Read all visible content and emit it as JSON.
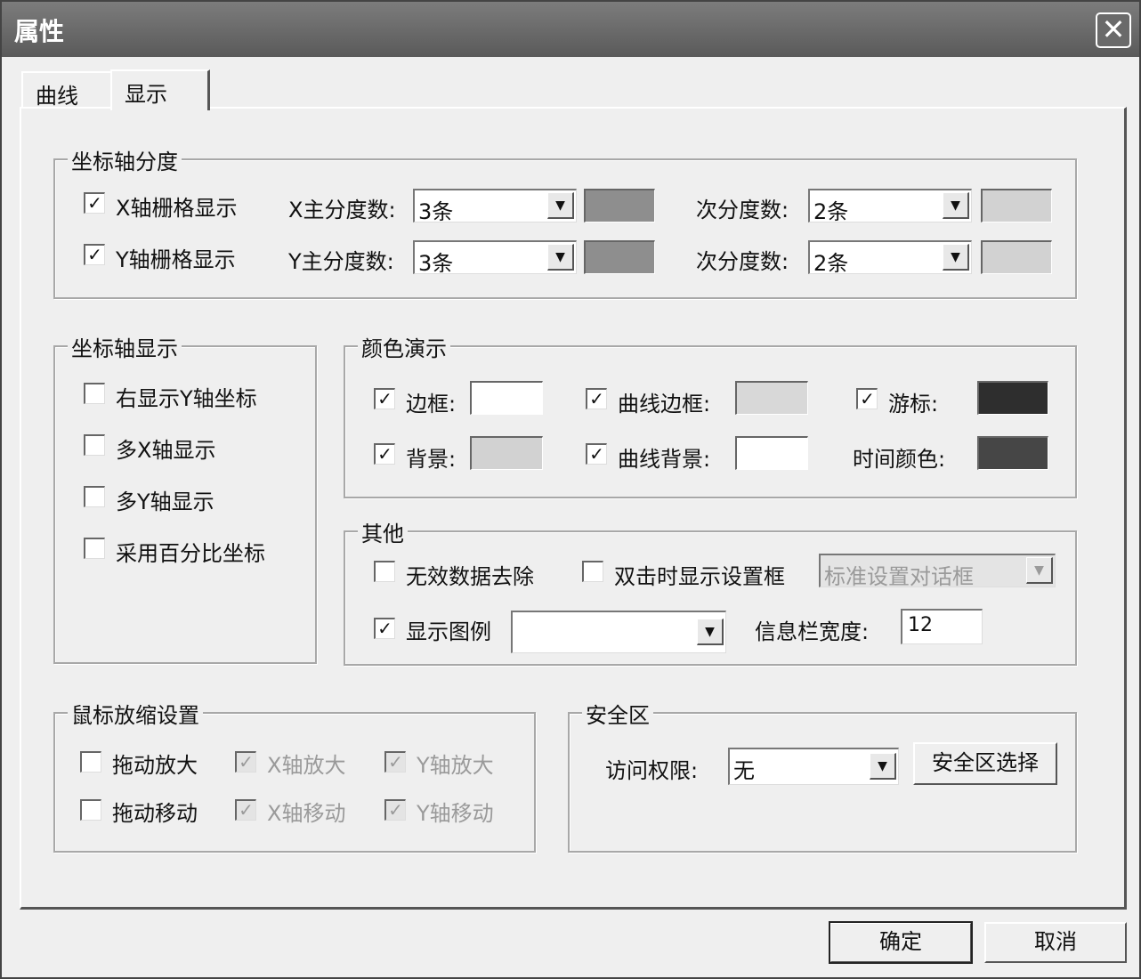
{
  "window": {
    "title": "属性",
    "close_glyph": "✕"
  },
  "tabs": [
    {
      "label": "曲线"
    },
    {
      "label": "显示"
    }
  ],
  "axis_division": {
    "legend": "坐标轴分度",
    "x_grid_label": "X轴栅格显示",
    "x_grid_checked": true,
    "y_grid_label": "Y轴栅格显示",
    "y_grid_checked": true,
    "x_major_label": "X主分度数:",
    "x_major_value": "3条",
    "x_major_color": "#8e8e8e",
    "x_minor_label": "次分度数:",
    "x_minor_value": "2条",
    "x_minor_color": "#d2d2d2",
    "y_major_label": "Y主分度数:",
    "y_major_value": "3条",
    "y_major_color": "#8e8e8e",
    "y_minor_label": "次分度数:",
    "y_minor_value": "2条",
    "y_minor_color": "#d2d2d2"
  },
  "axis_display": {
    "legend": "坐标轴显示",
    "items": [
      {
        "label": "右显示Y轴坐标",
        "checked": false
      },
      {
        "label": "多X轴显示",
        "checked": false
      },
      {
        "label": "多Y轴显示",
        "checked": false
      },
      {
        "label": "采用百分比坐标",
        "checked": false
      }
    ]
  },
  "color_demo": {
    "legend": "颜色演示",
    "border_label": "边框:",
    "border_checked": true,
    "border_color": "#ffffff",
    "curve_border_label": "曲线边框:",
    "curve_border_checked": true,
    "curve_border_color": "#d8d8d8",
    "cursor_label": "游标:",
    "cursor_checked": true,
    "cursor_color": "#2e2e2e",
    "background_label": "背景:",
    "background_checked": true,
    "background_color": "#d2d2d2",
    "curve_bg_label": "曲线背景:",
    "curve_bg_checked": true,
    "curve_bg_color": "#ffffff",
    "time_color_label": "时间颜色:",
    "time_color": "#464646"
  },
  "other": {
    "legend": "其他",
    "remove_invalid_label": "无效数据去除",
    "remove_invalid_checked": false,
    "dblclick_label": "双击时显示设置框",
    "dblclick_checked": false,
    "dialog_combo_value": "标准设置对话框",
    "show_legend_label": "显示图例",
    "show_legend_checked": true,
    "legend_combo_value": "",
    "info_width_label": "信息栏宽度:",
    "info_width_value": "12"
  },
  "mouse_zoom": {
    "legend": "鼠标放缩设置",
    "drag_zoom_label": "拖动放大",
    "drag_zoom_checked": false,
    "x_zoom_label": "X轴放大",
    "y_zoom_label": "Y轴放大",
    "drag_move_label": "拖动移动",
    "drag_move_checked": false,
    "x_move_label": "X轴移动",
    "y_move_label": "Y轴移动"
  },
  "safety": {
    "legend": "安全区",
    "access_label": "访问权限:",
    "access_value": "无",
    "select_button": "安全区选择"
  },
  "footer": {
    "ok": "确定",
    "cancel": "取消"
  },
  "glyphs": {
    "check": "✓",
    "arrow": "▼"
  }
}
